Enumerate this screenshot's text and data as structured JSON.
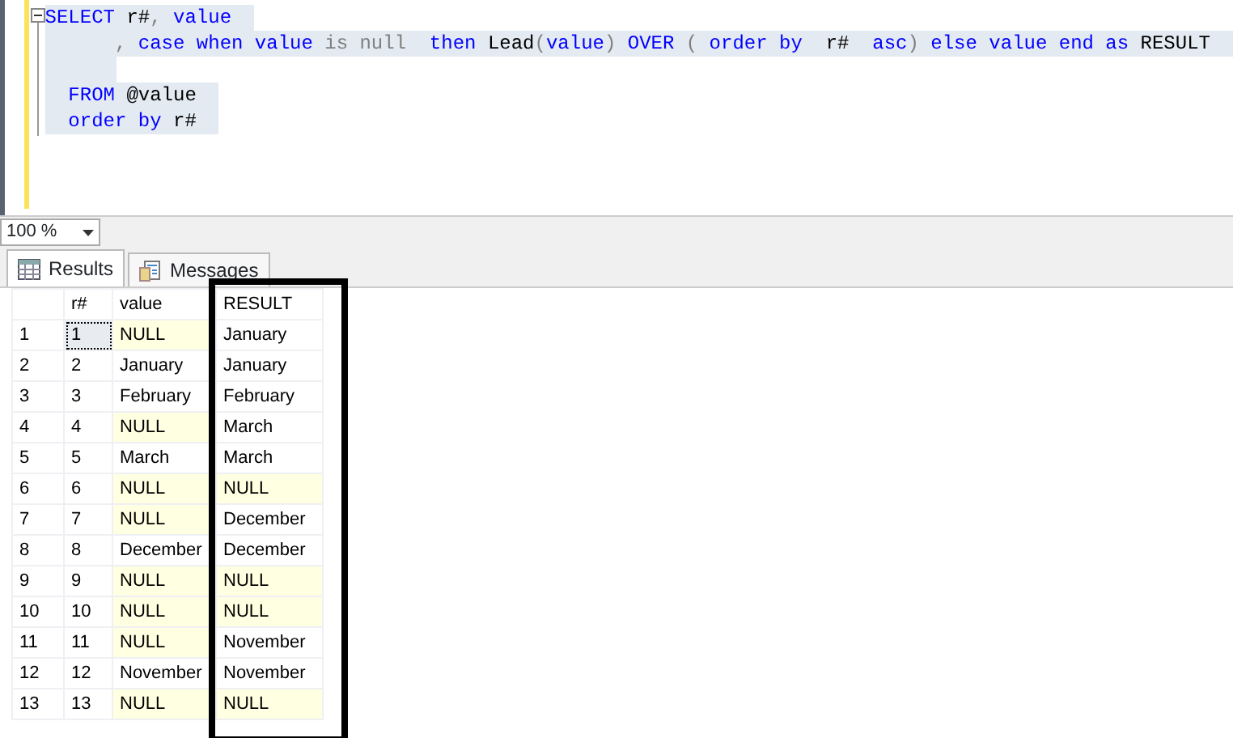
{
  "editor": {
    "lines": [
      {
        "selected": true,
        "collapse": true,
        "tokens": [
          {
            "text": "SELECT",
            "kind": "keyword"
          },
          {
            "text": " r#",
            "kind": "plain"
          },
          {
            "text": ",",
            "kind": "operator"
          },
          {
            "text": " value",
            "kind": "keyword"
          }
        ]
      },
      {
        "selected": true,
        "tokens": [
          {
            "text": "      ,",
            "kind": "operator"
          },
          {
            "text": " case when value",
            "kind": "keyword"
          },
          {
            "text": " is null",
            "kind": "operator"
          },
          {
            "text": "  then",
            "kind": "keyword"
          },
          {
            "text": " Lead",
            "kind": "plain"
          },
          {
            "text": "(",
            "kind": "operator"
          },
          {
            "text": "value",
            "kind": "keyword"
          },
          {
            "text": ")",
            "kind": "operator"
          },
          {
            "text": " OVER",
            "kind": "keyword"
          },
          {
            "text": " (",
            "kind": "operator"
          },
          {
            "text": " order by",
            "kind": "keyword"
          },
          {
            "text": "  r#",
            "kind": "plain"
          },
          {
            "text": "  asc",
            "kind": "keyword"
          },
          {
            "text": ")",
            "kind": "operator"
          },
          {
            "text": " else value end as",
            "kind": "keyword"
          },
          {
            "text": " RESULT",
            "kind": "plain"
          }
        ]
      },
      {
        "selected": true
      },
      {
        "selected": true,
        "tokens": [
          {
            "text": "  FROM",
            "kind": "keyword"
          },
          {
            "text": " @value",
            "kind": "plain"
          }
        ]
      },
      {
        "selected": true,
        "tokens": [
          {
            "text": "  order by",
            "kind": "keyword"
          },
          {
            "text": " r#",
            "kind": "plain"
          }
        ]
      }
    ]
  },
  "zoom": {
    "value": "100 %"
  },
  "tabs": [
    {
      "label": "Results",
      "selected": true
    },
    {
      "label": "Messages",
      "selected": false
    }
  ],
  "grid": {
    "columns": [
      {
        "label": "r#",
        "highlight": false
      },
      {
        "label": "value",
        "highlight": false
      },
      {
        "label": "RESULT",
        "highlight": true
      }
    ],
    "rows": [
      {
        "number": "1",
        "cells": [
          {
            "text": "1",
            "is_null": false,
            "focused": true
          },
          {
            "text": "NULL",
            "is_null": true,
            "focused": false
          },
          {
            "text": "January",
            "is_null": false,
            "focused": false
          }
        ]
      },
      {
        "number": "2",
        "cells": [
          {
            "text": "2",
            "is_null": false,
            "focused": false
          },
          {
            "text": "January",
            "is_null": false,
            "focused": false
          },
          {
            "text": "January",
            "is_null": false,
            "focused": false
          }
        ]
      },
      {
        "number": "3",
        "cells": [
          {
            "text": "3",
            "is_null": false,
            "focused": false
          },
          {
            "text": "February",
            "is_null": false,
            "focused": false
          },
          {
            "text": "February",
            "is_null": false,
            "focused": false
          }
        ]
      },
      {
        "number": "4",
        "cells": [
          {
            "text": "4",
            "is_null": false,
            "focused": false
          },
          {
            "text": "NULL",
            "is_null": true,
            "focused": false
          },
          {
            "text": "March",
            "is_null": false,
            "focused": false
          }
        ]
      },
      {
        "number": "5",
        "cells": [
          {
            "text": "5",
            "is_null": false,
            "focused": false
          },
          {
            "text": "March",
            "is_null": false,
            "focused": false
          },
          {
            "text": "March",
            "is_null": false,
            "focused": false
          }
        ]
      },
      {
        "number": "6",
        "cells": [
          {
            "text": "6",
            "is_null": false,
            "focused": false
          },
          {
            "text": "NULL",
            "is_null": true,
            "focused": false
          },
          {
            "text": "NULL",
            "is_null": true,
            "focused": false
          }
        ]
      },
      {
        "number": "7",
        "cells": [
          {
            "text": "7",
            "is_null": false,
            "focused": false
          },
          {
            "text": "NULL",
            "is_null": true,
            "focused": false
          },
          {
            "text": "December",
            "is_null": false,
            "focused": false
          }
        ]
      },
      {
        "number": "8",
        "cells": [
          {
            "text": "8",
            "is_null": false,
            "focused": false
          },
          {
            "text": "December",
            "is_null": false,
            "focused": false
          },
          {
            "text": "December",
            "is_null": false,
            "focused": false
          }
        ]
      },
      {
        "number": "9",
        "cells": [
          {
            "text": "9",
            "is_null": false,
            "focused": false
          },
          {
            "text": "NULL",
            "is_null": true,
            "focused": false
          },
          {
            "text": "NULL",
            "is_null": true,
            "focused": false
          }
        ]
      },
      {
        "number": "10",
        "cells": [
          {
            "text": "10",
            "is_null": false,
            "focused": false
          },
          {
            "text": "NULL",
            "is_null": true,
            "focused": false
          },
          {
            "text": "NULL",
            "is_null": true,
            "focused": false
          }
        ]
      },
      {
        "number": "11",
        "cells": [
          {
            "text": "11",
            "is_null": false,
            "focused": false
          },
          {
            "text": "NULL",
            "is_null": true,
            "focused": false
          },
          {
            "text": "November",
            "is_null": false,
            "focused": false
          }
        ]
      },
      {
        "number": "12",
        "cells": [
          {
            "text": "12",
            "is_null": false,
            "focused": false
          },
          {
            "text": "November",
            "is_null": false,
            "focused": false
          },
          {
            "text": "November",
            "is_null": false,
            "focused": false
          }
        ]
      },
      {
        "number": "13",
        "cells": [
          {
            "text": "13",
            "is_null": false,
            "focused": false
          },
          {
            "text": "NULL",
            "is_null": true,
            "focused": false
          },
          {
            "text": "NULL",
            "is_null": true,
            "focused": false
          }
        ]
      }
    ]
  }
}
